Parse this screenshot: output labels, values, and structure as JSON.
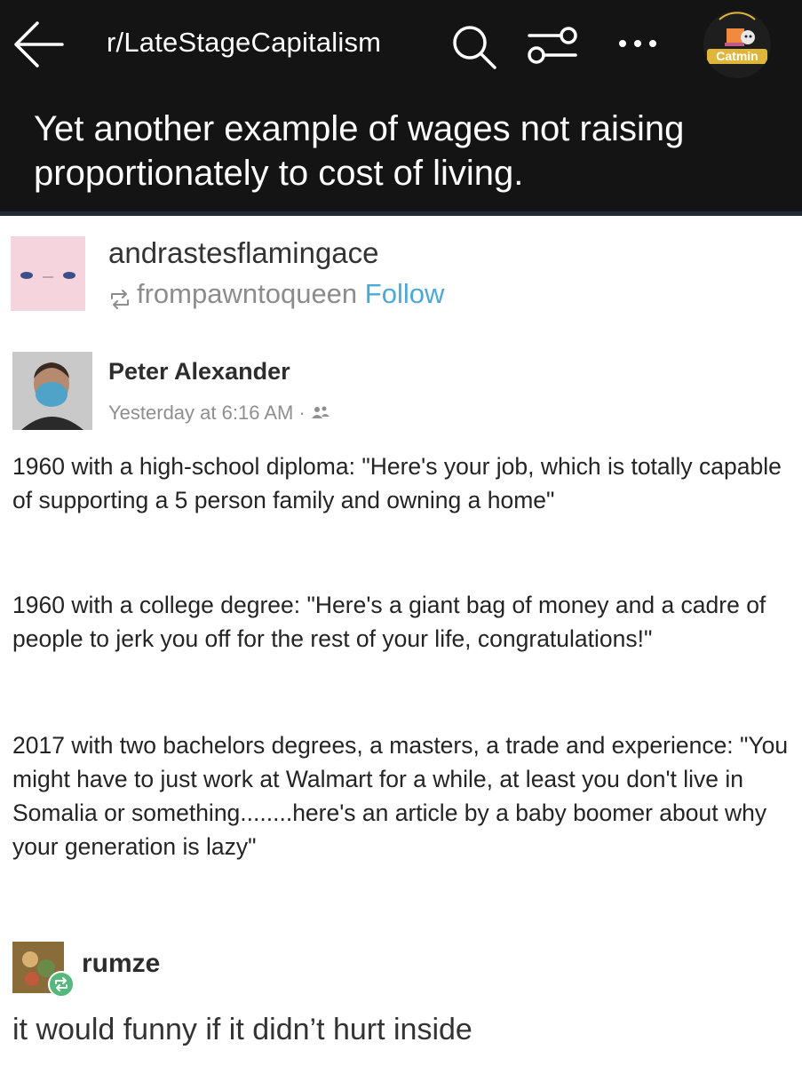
{
  "header": {
    "subreddit": "r/LateStageCapitalism",
    "title": "Yet another example of wages not raising proportionately to cost of living.",
    "badge_label": "Catmin",
    "icons": [
      "back-arrow-icon",
      "search-icon",
      "filter-icon",
      "more-icon"
    ]
  },
  "tumblr": {
    "blog_name": "andrastesflamingace",
    "reblogged_from": "frompawntoqueen",
    "follow_label": "Follow",
    "link_color": "#4aa9d8"
  },
  "facebook_post": {
    "author": "Peter Alexander",
    "timestamp": "Yesterday at 6:16 AM ·",
    "paragraphs": [
      "1960 with a high-school diploma: \"Here's your job, which is totally capable of supporting a 5 person family and owning a home\"",
      "1960 with a college degree: \"Here's a giant bag of money and a cadre of people to jerk you off for the rest of your life, congratulations!\"",
      "2017 with two bachelors degrees, a masters, a trade and experience: \"You might have to just work at Walmart for a while, at least you don't live in Somalia or something........here's an article by a baby boomer about why your generation is lazy\""
    ]
  },
  "reply": {
    "user": "rumze",
    "text": "it would funny if it didn’t hurt inside"
  }
}
